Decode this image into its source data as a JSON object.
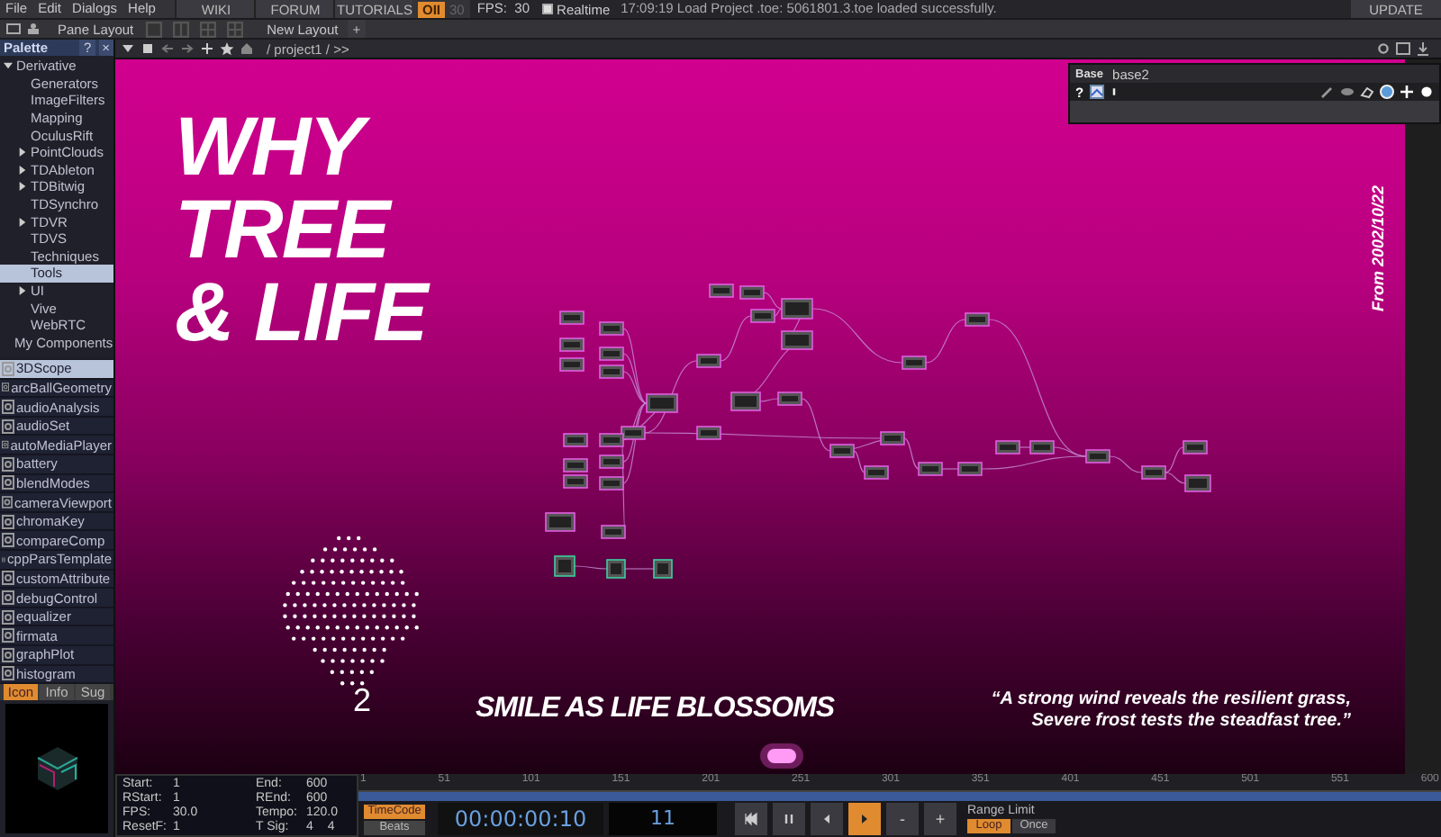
{
  "menu_bar": {
    "menus": [
      "File",
      "Edit",
      "Dialogs",
      "Help"
    ],
    "links": [
      "WIKI",
      "FORUM",
      "TUTORIALS"
    ],
    "perf_badge": "OII",
    "cook_rate": "30",
    "fps": "FPS:  30",
    "realtime": {
      "label": "Realtime",
      "checked": true
    },
    "message": "17:09:19 Load Project .toe: 5061801.3.toe loaded successfully.",
    "update": "UPDATE"
  },
  "layout_bar": {
    "pane_layout": "Pane Layout",
    "new_layout": "New Layout",
    "add": "+"
  },
  "palette": {
    "title": "Palette",
    "help": "?",
    "close": "×",
    "tree": [
      {
        "label": "Derivative",
        "kind": "folder",
        "expanded": true,
        "selected": false,
        "children": [
          {
            "label": "Generators",
            "kind": "leaf",
            "selected": false
          },
          {
            "label": "ImageFilters",
            "kind": "leaf",
            "selected": false
          },
          {
            "label": "Mapping",
            "kind": "leaf",
            "selected": false
          },
          {
            "label": "OculusRift",
            "kind": "leaf",
            "selected": false
          },
          {
            "label": "PointClouds",
            "kind": "folder",
            "expanded": false,
            "selected": false
          },
          {
            "label": "TDAbleton",
            "kind": "folder",
            "expanded": false,
            "selected": false
          },
          {
            "label": "TDBitwig",
            "kind": "folder",
            "expanded": false,
            "selected": false
          },
          {
            "label": "TDSynchro",
            "kind": "leaf",
            "selected": false
          },
          {
            "label": "TDVR",
            "kind": "folder",
            "expanded": false,
            "selected": false
          },
          {
            "label": "TDVS",
            "kind": "leaf",
            "selected": false
          },
          {
            "label": "Techniques",
            "kind": "leaf",
            "selected": false
          },
          {
            "label": "Tools",
            "kind": "leaf",
            "selected": true
          },
          {
            "label": "UI",
            "kind": "folder",
            "expanded": false,
            "selected": false
          },
          {
            "label": "Vive",
            "kind": "leaf",
            "selected": false
          },
          {
            "label": "WebRTC",
            "kind": "leaf",
            "selected": false
          }
        ]
      },
      {
        "label": "My Components",
        "kind": "leaf",
        "selected": false
      }
    ],
    "components": [
      {
        "label": "3DScope",
        "selected": true
      },
      {
        "label": "arcBallGeometry",
        "selected": false
      },
      {
        "label": "audioAnalysis",
        "selected": false
      },
      {
        "label": "audioSet",
        "selected": false
      },
      {
        "label": "autoMediaPlayer",
        "selected": false
      },
      {
        "label": "battery",
        "selected": false
      },
      {
        "label": "blendModes",
        "selected": false
      },
      {
        "label": "cameraViewport",
        "selected": false
      },
      {
        "label": "chromaKey",
        "selected": false
      },
      {
        "label": "compareComp",
        "selected": false
      },
      {
        "label": "cppParsTemplate",
        "selected": false
      },
      {
        "label": "customAttribute",
        "selected": false
      },
      {
        "label": "debugControl",
        "selected": false
      },
      {
        "label": "equalizer",
        "selected": false
      },
      {
        "label": "firmata",
        "selected": false
      },
      {
        "label": "graphPlot",
        "selected": false
      },
      {
        "label": "histogram",
        "selected": false
      }
    ],
    "tabs": [
      {
        "label": "Icon",
        "selected": true
      },
      {
        "label": "Info",
        "selected": false
      },
      {
        "label": "Sug",
        "selected": false
      }
    ]
  },
  "network": {
    "path": "/ project1 / >>",
    "base_panel": {
      "type": "Base",
      "name": "base2",
      "help": "?"
    },
    "title_lines": [
      "WHY",
      "TREE",
      "& LIFE"
    ],
    "date": "From 2002/10/22",
    "face_label": "2",
    "caption": "SMILE AS LIFE BLOSSOMS",
    "quote_lines": [
      "“A strong wind reveals the resilient grass,",
      "Severe frost tests the steadfast tree.”"
    ]
  },
  "info_panel": {
    "fields": [
      {
        "label": "Start:",
        "value": "1"
      },
      {
        "label": "End:",
        "value": "600"
      },
      {
        "label": "RStart:",
        "value": "1"
      },
      {
        "label": "REnd:",
        "value": "600"
      },
      {
        "label": "FPS:",
        "value": "30.0"
      },
      {
        "label": "Tempo:",
        "value": "120.0"
      },
      {
        "label": "ResetF:",
        "value": "1"
      },
      {
        "label": "T Sig:",
        "value": "4",
        "value2": "4"
      }
    ]
  },
  "timeline": {
    "ticks": [
      "1",
      "51",
      "101",
      "151",
      "201",
      "251",
      "301",
      "351",
      "401",
      "451",
      "501",
      "551",
      "600"
    ],
    "modes": [
      {
        "label": "TimeCode",
        "selected": true
      },
      {
        "label": "Beats",
        "selected": false
      }
    ],
    "timecode": "00:00:00:10",
    "frame": "11",
    "transport": [
      {
        "kind": "rewind",
        "selected": false
      },
      {
        "kind": "pause",
        "selected": false
      },
      {
        "kind": "back",
        "selected": false
      },
      {
        "kind": "play",
        "selected": true
      },
      {
        "kind": "text",
        "label": "-",
        "selected": false
      },
      {
        "kind": "text",
        "label": "+",
        "selected": false
      }
    ],
    "range_label": "Range Limit",
    "range_options": [
      {
        "label": "Loop",
        "selected": true
      },
      {
        "label": "Once",
        "selected": false
      }
    ]
  }
}
